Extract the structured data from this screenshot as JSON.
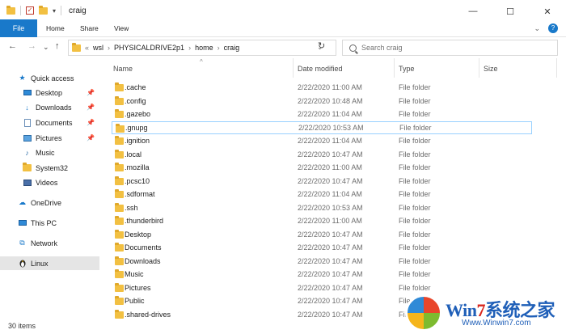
{
  "window": {
    "title": "craig",
    "controls": [
      "—",
      "☐",
      "✕"
    ]
  },
  "ribbon": {
    "tabs": [
      "File",
      "Home",
      "Share",
      "View"
    ]
  },
  "address": {
    "back": "←",
    "forward": "→",
    "recent": "⌄",
    "up": "↑",
    "crumbs": [
      "wsl",
      "PHYSICALDRIVE2p1",
      "home",
      "craig"
    ],
    "separator": "›",
    "overflow": "«",
    "refresh": "↻",
    "search_placeholder": "Search craig"
  },
  "sidebar": {
    "items": [
      {
        "label": "Quick access",
        "icon": "star-icon",
        "pinned": false
      },
      {
        "label": "Desktop",
        "icon": "desktop-icon",
        "pinned": true
      },
      {
        "label": "Downloads",
        "icon": "download-icon",
        "pinned": true
      },
      {
        "label": "Documents",
        "icon": "documents-icon",
        "pinned": true
      },
      {
        "label": "Pictures",
        "icon": "pictures-icon",
        "pinned": true
      },
      {
        "label": "Music",
        "icon": "music-icon",
        "pinned": false
      },
      {
        "label": "System32",
        "icon": "folder-icon",
        "pinned": false
      },
      {
        "label": "Videos",
        "icon": "videos-icon",
        "pinned": false
      },
      {
        "label": "OneDrive",
        "icon": "cloud-icon",
        "pinned": false
      },
      {
        "label": "This PC",
        "icon": "computer-icon",
        "pinned": false
      },
      {
        "label": "Network",
        "icon": "network-icon",
        "pinned": false
      },
      {
        "label": "Linux",
        "icon": "penguin-icon",
        "pinned": false
      }
    ],
    "selected": "Linux"
  },
  "columns": {
    "name": "Name",
    "date": "Date modified",
    "type": "Type",
    "size": "Size"
  },
  "files": [
    {
      "name": ".cache",
      "date": "2/22/2020 11:00 AM",
      "type": "File folder"
    },
    {
      "name": ".config",
      "date": "2/22/2020 10:48 AM",
      "type": "File folder"
    },
    {
      "name": ".gazebo",
      "date": "2/22/2020 11:04 AM",
      "type": "File folder"
    },
    {
      "name": ".gnupg",
      "date": "2/22/2020 10:53 AM",
      "type": "File folder"
    },
    {
      "name": ".ignition",
      "date": "2/22/2020 11:04 AM",
      "type": "File folder"
    },
    {
      "name": ".local",
      "date": "2/22/2020 10:47 AM",
      "type": "File folder"
    },
    {
      "name": ".mozilla",
      "date": "2/22/2020 11:00 AM",
      "type": "File folder"
    },
    {
      "name": ".pcsc10",
      "date": "2/22/2020 10:47 AM",
      "type": "File folder"
    },
    {
      "name": ".sdformat",
      "date": "2/22/2020 11:04 AM",
      "type": "File folder"
    },
    {
      "name": ".ssh",
      "date": "2/22/2020 10:53 AM",
      "type": "File folder"
    },
    {
      "name": ".thunderbird",
      "date": "2/22/2020 11:00 AM",
      "type": "File folder"
    },
    {
      "name": "Desktop",
      "date": "2/22/2020 10:47 AM",
      "type": "File folder"
    },
    {
      "name": "Documents",
      "date": "2/22/2020 10:47 AM",
      "type": "File folder"
    },
    {
      "name": "Downloads",
      "date": "2/22/2020 10:47 AM",
      "type": "File folder"
    },
    {
      "name": "Music",
      "date": "2/22/2020 10:47 AM",
      "type": "File folder"
    },
    {
      "name": "Pictures",
      "date": "2/22/2020 10:47 AM",
      "type": "File folder"
    },
    {
      "name": "Public",
      "date": "2/22/2020 10:47 AM",
      "type": "File folder"
    },
    {
      "name": ".shared-drives",
      "date": "2/22/2020 10:47 AM",
      "type": "File folder"
    }
  ],
  "focused_row": 3,
  "status": {
    "items_count": "30 items"
  },
  "watermark": {
    "brand": "Win7系统之家",
    "url": "Www.Winwin7.com"
  },
  "colors": {
    "accent": "#1979ca",
    "folder": "#f2c042",
    "selection_border": "#99d1ff",
    "nav_selected": "#e5e5e5"
  }
}
